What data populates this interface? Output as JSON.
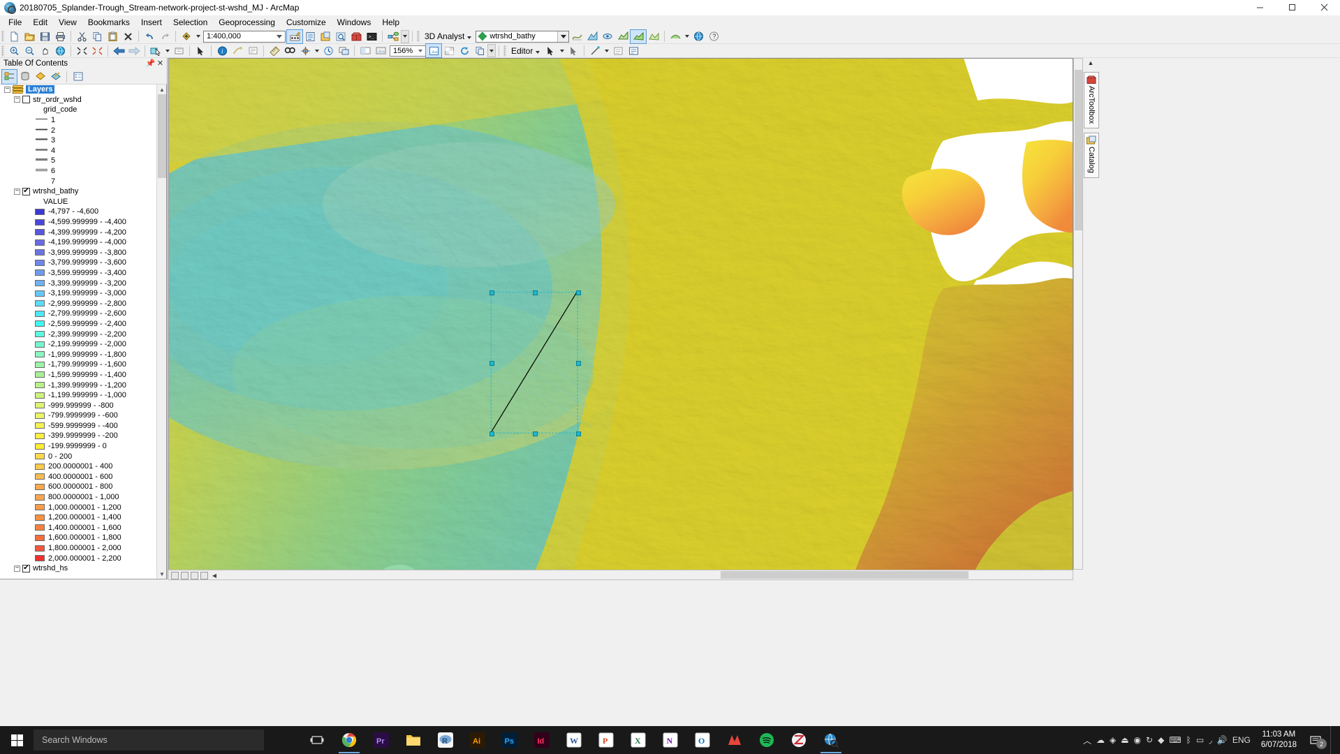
{
  "window": {
    "title": "20180705_Splander-Trough_Stream-network-project-st-wshd_MJ - ArcMap",
    "app_icon": "arcmap-globe-icon",
    "minimize_label": "—",
    "maximize_label": "❐",
    "close_label": "✕"
  },
  "menu": {
    "items": [
      {
        "label": "File"
      },
      {
        "label": "Edit"
      },
      {
        "label": "View"
      },
      {
        "label": "Bookmarks"
      },
      {
        "label": "Insert"
      },
      {
        "label": "Selection"
      },
      {
        "label": "Geoprocessing"
      },
      {
        "label": "Customize"
      },
      {
        "label": "Windows"
      },
      {
        "label": "Help"
      }
    ]
  },
  "toolbar_standard": {
    "scale_value": "1:400,000",
    "extension_label": "3D Analyst",
    "layer_value": "wtrshd_bathy",
    "buttons": [
      {
        "name": "new-map-button",
        "tip": "New Map File"
      },
      {
        "name": "open-button",
        "tip": "Open"
      },
      {
        "name": "save-button",
        "tip": "Save"
      },
      {
        "name": "print-button",
        "tip": "Print"
      },
      {
        "name": "cut-button",
        "tip": "Cut"
      },
      {
        "name": "copy-button",
        "tip": "Copy"
      },
      {
        "name": "paste-button",
        "tip": "Paste"
      },
      {
        "name": "delete-button",
        "tip": "Delete"
      },
      {
        "name": "undo-button",
        "tip": "Undo"
      },
      {
        "name": "redo-button",
        "tip": "Redo"
      },
      {
        "name": "add-data-button",
        "tip": "Add Data"
      },
      {
        "name": "editor-toolbar-button",
        "tip": "Editor Toolbar"
      },
      {
        "name": "table-of-contents-button",
        "tip": "Table Of Contents"
      },
      {
        "name": "catalog-button",
        "tip": "Catalog"
      },
      {
        "name": "search-button",
        "tip": "Search"
      },
      {
        "name": "arctoolbox-button",
        "tip": "ArcToolbox"
      },
      {
        "name": "python-window-button",
        "tip": "Python Window"
      },
      {
        "name": "model-builder-button",
        "tip": "ModelBuilder"
      }
    ]
  },
  "toolbar_tools": {
    "zoom_value": "156%",
    "editor_label": "Editor",
    "buttons": [
      {
        "name": "zoom-in-button",
        "tip": "Zoom In"
      },
      {
        "name": "zoom-out-button",
        "tip": "Zoom Out"
      },
      {
        "name": "pan-button",
        "tip": "Pan"
      },
      {
        "name": "full-extent-button",
        "tip": "Full Extent"
      },
      {
        "name": "fixed-zoom-in-button",
        "tip": "Fixed Zoom In"
      },
      {
        "name": "fixed-zoom-out-button",
        "tip": "Fixed Zoom Out"
      },
      {
        "name": "go-back-extent-button",
        "tip": "Go Back To Previous Extent"
      },
      {
        "name": "go-forward-extent-button",
        "tip": "Go To Next Extent"
      },
      {
        "name": "select-features-button",
        "tip": "Select Features"
      },
      {
        "name": "clear-selection-button",
        "tip": "Clear Selected Features"
      },
      {
        "name": "select-elements-button",
        "tip": "Select Elements"
      },
      {
        "name": "identify-button",
        "tip": "Identify"
      },
      {
        "name": "hyperlink-button",
        "tip": "Hyperlink"
      },
      {
        "name": "html-popup-button",
        "tip": "HTML Popup"
      },
      {
        "name": "measure-button",
        "tip": "Measure"
      },
      {
        "name": "find-button",
        "tip": "Find"
      },
      {
        "name": "go-to-xy-button",
        "tip": "Go To XY"
      },
      {
        "name": "time-slider-button",
        "tip": "Time Slider"
      },
      {
        "name": "create-viewer-button",
        "tip": "Create Viewer Window"
      }
    ]
  },
  "toc": {
    "title": "Table Of Contents",
    "pin_icon": "pin-icon",
    "close_icon": "close-icon",
    "tools": [
      {
        "name": "list-by-drawing-order-button",
        "selected": true
      },
      {
        "name": "list-by-source-button",
        "selected": false
      },
      {
        "name": "list-by-visibility-button",
        "selected": false
      },
      {
        "name": "list-by-selection-button",
        "selected": false
      },
      {
        "name": "options-button",
        "selected": false
      }
    ],
    "root": "Layers",
    "layers": [
      {
        "name": "str_ordr_wshd",
        "checked": false,
        "field": "grid_code",
        "classes": [
          {
            "label": "1",
            "width": 1.0,
            "color": "#3a3a3a"
          },
          {
            "label": "2",
            "width": 1.8,
            "color": "#3a3a3a"
          },
          {
            "label": "3",
            "width": 2.2,
            "color": "#555555"
          },
          {
            "label": "4",
            "width": 2.6,
            "color": "#6e6e6e"
          },
          {
            "label": "5",
            "width": 3.2,
            "color": "#7d7d7d"
          },
          {
            "label": "6",
            "width": 3.8,
            "color": "#a0a0a0"
          },
          {
            "label": "7",
            "width": 0,
            "color": "#ffffff"
          }
        ]
      },
      {
        "name": "wtrshd_bathy",
        "checked": true,
        "field": "VALUE",
        "classes": [
          {
            "label": "-4,797 -  -4,600",
            "color": "#3b38d9"
          },
          {
            "label": "-4,599.999999 -  -4,400",
            "color": "#4a46dd"
          },
          {
            "label": "-4,399.999999 -  -4,200",
            "color": "#5855e0"
          },
          {
            "label": "-4,199.999999 -  -4,000",
            "color": "#6a6ae6"
          },
          {
            "label": "-3,999.999999 -  -3,800",
            "color": "#6b74e3"
          },
          {
            "label": "-3,799.999999 -  -3,600",
            "color": "#6f85e8"
          },
          {
            "label": "-3,599.999999 -  -3,400",
            "color": "#6f9bee"
          },
          {
            "label": "-3,399.999999 -  -3,200",
            "color": "#6fb2f3"
          },
          {
            "label": "-3,199.999999 -  -3,000",
            "color": "#64c8f7"
          },
          {
            "label": "-2,999.999999 -  -2,800",
            "color": "#5cdcf8"
          },
          {
            "label": "-2,799.999999 -  -2,600",
            "color": "#4ce8f5"
          },
          {
            "label": "-2,599.999999 -  -2,400",
            "color": "#3ff7f0"
          },
          {
            "label": "-2,399.999999 -  -2,200",
            "color": "#5cf8df"
          },
          {
            "label": "-2,199.999999 -  -2,000",
            "color": "#74f7cf"
          },
          {
            "label": "-1,999.999999 -  -1,800",
            "color": "#8bf5bd"
          },
          {
            "label": "-1,799.999999 -  -1,600",
            "color": "#9cf3a9"
          },
          {
            "label": "-1,599.999999 -  -1,400",
            "color": "#a8f095"
          },
          {
            "label": "-1,399.999999 -  -1,200",
            "color": "#bbf089"
          },
          {
            "label": "-1,199.999999 -  -1,000",
            "color": "#cdf37d"
          },
          {
            "label": "-999.999999 -  -800",
            "color": "#ddf471"
          },
          {
            "label": "-799.9999999 -  -600",
            "color": "#ebf468"
          },
          {
            "label": "-599.9999999 -  -400",
            "color": "#f6f252"
          },
          {
            "label": "-399.9999999 -  -200",
            "color": "#fbee44"
          },
          {
            "label": "-199.9999999 - 0",
            "color": "#fded35"
          },
          {
            "label": "0 - 200",
            "color": "#fbd94a"
          },
          {
            "label": "200.0000001 - 400",
            "color": "#fcc94e"
          },
          {
            "label": "400.0000001 - 600",
            "color": "#fbbc52"
          },
          {
            "label": "600.0000001 - 800",
            "color": "#faa94f"
          },
          {
            "label": "800.0000001 - 1,000",
            "color": "#f9a652"
          },
          {
            "label": "1,000.000001 - 1,200",
            "color": "#f99c4a"
          },
          {
            "label": "1,200.000001 - 1,400",
            "color": "#f8913f"
          },
          {
            "label": "1,400.000001 - 1,600",
            "color": "#f7823b"
          },
          {
            "label": "1,600.000001 - 1,800",
            "color": "#f56e3b"
          },
          {
            "label": "1,800.000001 - 2,000",
            "color": "#f4563a"
          },
          {
            "label": "2,000.000001 - 2,200",
            "color": "#f22f2f"
          }
        ]
      },
      {
        "name": "wtrshd_hs",
        "checked": true,
        "field": "",
        "classes": []
      }
    ]
  },
  "map": {
    "status_buttons": [
      {
        "name": "map-view-button"
      },
      {
        "name": "layout-view-button"
      },
      {
        "name": "refresh-button"
      },
      {
        "name": "pause-drawing-button"
      },
      {
        "name": "scroll-left-button"
      }
    ],
    "selection_graphic": {
      "name": "selected-line-feature",
      "handles": 8
    }
  },
  "right_dock": {
    "collapse_icon": "chevron-up-icon",
    "tabs": [
      {
        "label": "ArcToolbox",
        "icon": "arctoolbox-icon"
      },
      {
        "label": "Catalog",
        "icon": "catalog-icon"
      }
    ]
  },
  "taskbar": {
    "start_icon": "windows-logo-icon",
    "search_placeholder": "Search Windows",
    "task_view_icon": "task-view-icon",
    "apps": [
      {
        "name": "chrome-icon",
        "label": "",
        "color": "#f4f4f4"
      },
      {
        "name": "premiere-icon",
        "label": "Pr",
        "color": "#2a0d45"
      },
      {
        "name": "file-explorer-icon",
        "label": "",
        "color": "#ffc83d"
      },
      {
        "name": "r-studio-icon",
        "label": "R",
        "color": "#2a6fc9"
      },
      {
        "name": "illustrator-icon",
        "label": "Ai",
        "color": "#2b1b05"
      },
      {
        "name": "photoshop-icon",
        "label": "Ps",
        "color": "#001e36"
      },
      {
        "name": "indesign-icon",
        "label": "Id",
        "color": "#310019"
      },
      {
        "name": "word-icon",
        "label": "W",
        "color": "#ffffff"
      },
      {
        "name": "powerpoint-icon",
        "label": "P",
        "color": "#ffffff"
      },
      {
        "name": "excel-icon",
        "label": "X",
        "color": "#ffffff"
      },
      {
        "name": "onenote-icon",
        "label": "N",
        "color": "#ffffff"
      },
      {
        "name": "outlook-icon",
        "label": "O",
        "color": "#ffffff"
      },
      {
        "name": "max-icon",
        "label": "",
        "color": "#1a1a1a"
      },
      {
        "name": "spotify-icon",
        "label": "",
        "color": "#1a1a1a"
      },
      {
        "name": "zotero-icon",
        "label": "",
        "color": "#1a1a1a"
      },
      {
        "name": "arcmap-icon",
        "label": "",
        "color": "#1a1a1a"
      }
    ],
    "tray": {
      "icons": [
        {
          "name": "show-hidden-icons-chevron"
        },
        {
          "name": "onedrive-icon"
        },
        {
          "name": "dropbox-icon"
        },
        {
          "name": "safely-remove-hardware-icon"
        },
        {
          "name": "battery-icon"
        },
        {
          "name": "bluetooth-icon"
        },
        {
          "name": "nvidia-icon"
        },
        {
          "name": "network-icon"
        },
        {
          "name": "chrome-tray-icon"
        },
        {
          "name": "teamviewer-icon"
        },
        {
          "name": "keyboard-icon"
        },
        {
          "name": "antivirus-icon"
        },
        {
          "name": "power-icon"
        },
        {
          "name": "wifi-icon"
        },
        {
          "name": "volume-icon"
        }
      ],
      "language": "ENG",
      "time": "11:03 AM",
      "date": "6/07/2018",
      "notification_count": "2"
    }
  }
}
